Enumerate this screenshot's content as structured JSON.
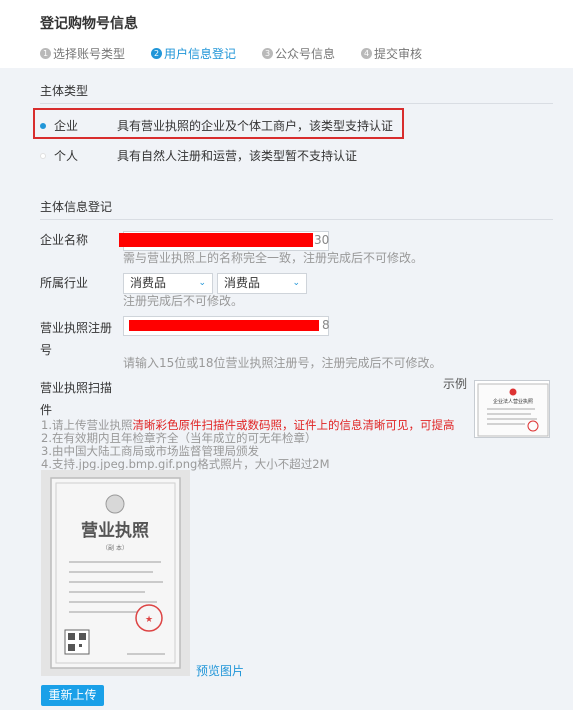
{
  "header": {
    "title": "登记购物号信息",
    "steps": [
      {
        "num": "1",
        "label": "选择账号类型"
      },
      {
        "num": "2",
        "label": "用户信息登记"
      },
      {
        "num": "3",
        "label": "公众号信息"
      },
      {
        "num": "4",
        "label": "提交审核"
      }
    ]
  },
  "entity_type": {
    "title": "主体类型",
    "options": [
      {
        "name": "企业",
        "desc": "具有营业执照的企业及个体工商户，该类型支持认证",
        "selected": true
      },
      {
        "name": "个人",
        "desc": "具有自然人注册和运营，该类型暂不支持认证",
        "selected": false
      }
    ]
  },
  "entity_info": {
    "title": "主体信息登记",
    "company_name": {
      "label": "企业名称",
      "counter": "30",
      "hint": "需与营业执照上的名称完全一致，注册完成后不可修改。"
    },
    "industry": {
      "label": "所属行业",
      "select1": "消费品",
      "select2": "消费品",
      "hint": "注册完成后不可修改。"
    },
    "license_no": {
      "label_line1": "营业执照注册",
      "label_line2": "号",
      "counter": "8",
      "hint": "请输入15位或18位营业执照注册号，注册完成后不可修改。"
    },
    "license_scan": {
      "label_line1": "营业执照扫描",
      "label_line2": "件",
      "example_label": "示例",
      "req1_prefix": "1.请上传营业执照",
      "req1_red": "清晰彩色原件扫描件或数码照，证件上的信息清晰可见，可提高",
      "req2": "2.在有效期内且年检章齐全（当年成立的可无年检章）",
      "req3": "3.由中国大陆工商局或市场监督管理局颁发",
      "req4": "4.支持.jpg.jpeg.bmp.gif.png格式照片，大小不超过2M",
      "preview_link": "预览图片",
      "reupload_button": "重新上传"
    }
  },
  "license_image": {
    "title": "营业执照",
    "subtitle": "（副 本）"
  },
  "example_image": {
    "title": "企业法人营业执照"
  },
  "colors": {
    "accent": "#2196d8",
    "highlight_border": "#d82d2d",
    "redaction": "#ff0000",
    "button": "#1aa0e8"
  }
}
